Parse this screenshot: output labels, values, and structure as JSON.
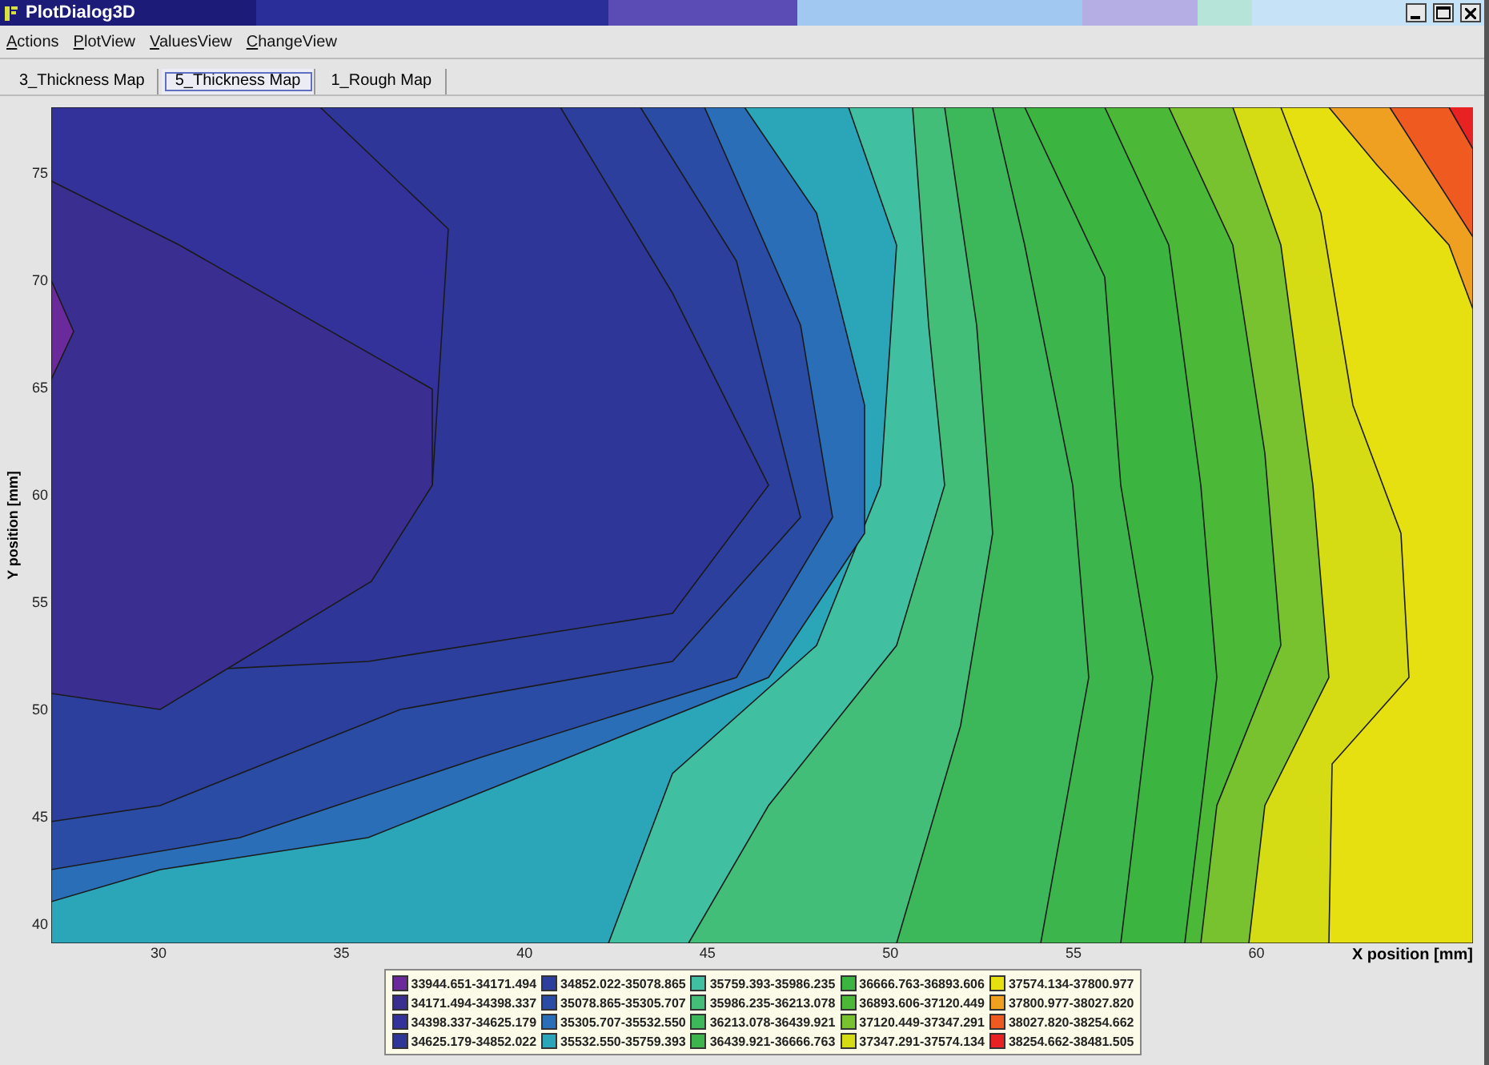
{
  "window": {
    "title": "PlotDialog3D"
  },
  "menu": [
    "Actions",
    "PlotView",
    "ValuesView",
    "ChangeView"
  ],
  "tabs": [
    {
      "label": "3_Thickness Map",
      "selected": false
    },
    {
      "label": "5_Thickness Map",
      "selected": true
    },
    {
      "label": "1_Rough Map",
      "selected": false
    }
  ],
  "plot": {
    "y_axis": {
      "label": "Y position [mm]",
      "ticks": [
        "75",
        "70",
        "65",
        "60",
        "55",
        "50",
        "45",
        "40"
      ]
    },
    "x_axis": {
      "label": "X position [mm]",
      "ticks": [
        "30",
        "35",
        "40",
        "45",
        "50",
        "55",
        "60"
      ]
    },
    "legend": [
      {
        "label": "33944.651-34171.494",
        "color": "#6a2a9c"
      },
      {
        "label": "34171.494-34398.337",
        "color": "#3a2f90"
      },
      {
        "label": "34398.337-34625.179",
        "color": "#33329a"
      },
      {
        "label": "34625.179-34852.022",
        "color": "#2e3798"
      },
      {
        "label": "34852.022-35078.865",
        "color": "#2c3f9c"
      },
      {
        "label": "35078.865-35305.707",
        "color": "#2b4ca4"
      },
      {
        "label": "35305.707-35532.550",
        "color": "#2a6eb8"
      },
      {
        "label": "35532.550-35759.393",
        "color": "#2aa6b8"
      },
      {
        "label": "35759.393-35986.235",
        "color": "#40c0a0"
      },
      {
        "label": "35986.235-36213.078",
        "color": "#42be78"
      },
      {
        "label": "36213.078-36439.921",
        "color": "#3cb85a"
      },
      {
        "label": "36439.921-36666.763",
        "color": "#3cb64c"
      },
      {
        "label": "36666.763-36893.606",
        "color": "#3cb440"
      },
      {
        "label": "36893.606-37120.449",
        "color": "#4cb838"
      },
      {
        "label": "37120.449-37347.291",
        "color": "#78c230"
      },
      {
        "label": "37347.291-37574.134",
        "color": "#d6dc14"
      },
      {
        "label": "37574.134-37800.977",
        "color": "#e6e010"
      },
      {
        "label": "37800.977-38027.820",
        "color": "#f0a020"
      },
      {
        "label": "38027.820-38254.662",
        "color": "#ee5a20"
      },
      {
        "label": "38254.662-38481.505",
        "color": "#e82222"
      }
    ]
  }
}
